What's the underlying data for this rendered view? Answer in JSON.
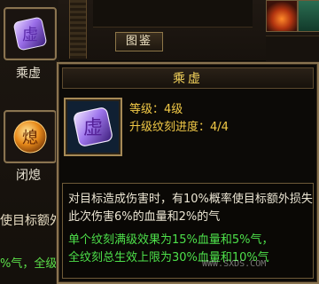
{
  "left_panel": {
    "skill1": {
      "label": "乘虚",
      "icon": "purple-gem-icon",
      "glyph": "虚"
    },
    "skill2": {
      "label": "闭熄",
      "icon": "orange-orb-icon",
      "glyph": "熄"
    },
    "bg_text1": "使目标额外",
    "bg_text2": "%气，全级"
  },
  "top_bar": {
    "gallery_button": "图鉴"
  },
  "tooltip": {
    "title": "乘虚",
    "glyph": "虚",
    "level": "等级：4级",
    "progress": "升级纹刻进度：4/4",
    "description": "对目标造成伤害时，有10%概率使目标额外损失此次伤害6%的血量和2%的气",
    "green1": "单个纹刻满级效果为15%血量和5%气，",
    "green2": "全纹刻总生效上限为30%血量和10%气"
  },
  "watermark": {
    "url": "WWW.SXDS.COM"
  },
  "colors": {
    "title_yellow": "#f4d35c",
    "stat_yellow": "#f2ca47",
    "green": "#4de04a",
    "border_gold": "#8a7450",
    "gem_purple": "#8a5de0"
  }
}
